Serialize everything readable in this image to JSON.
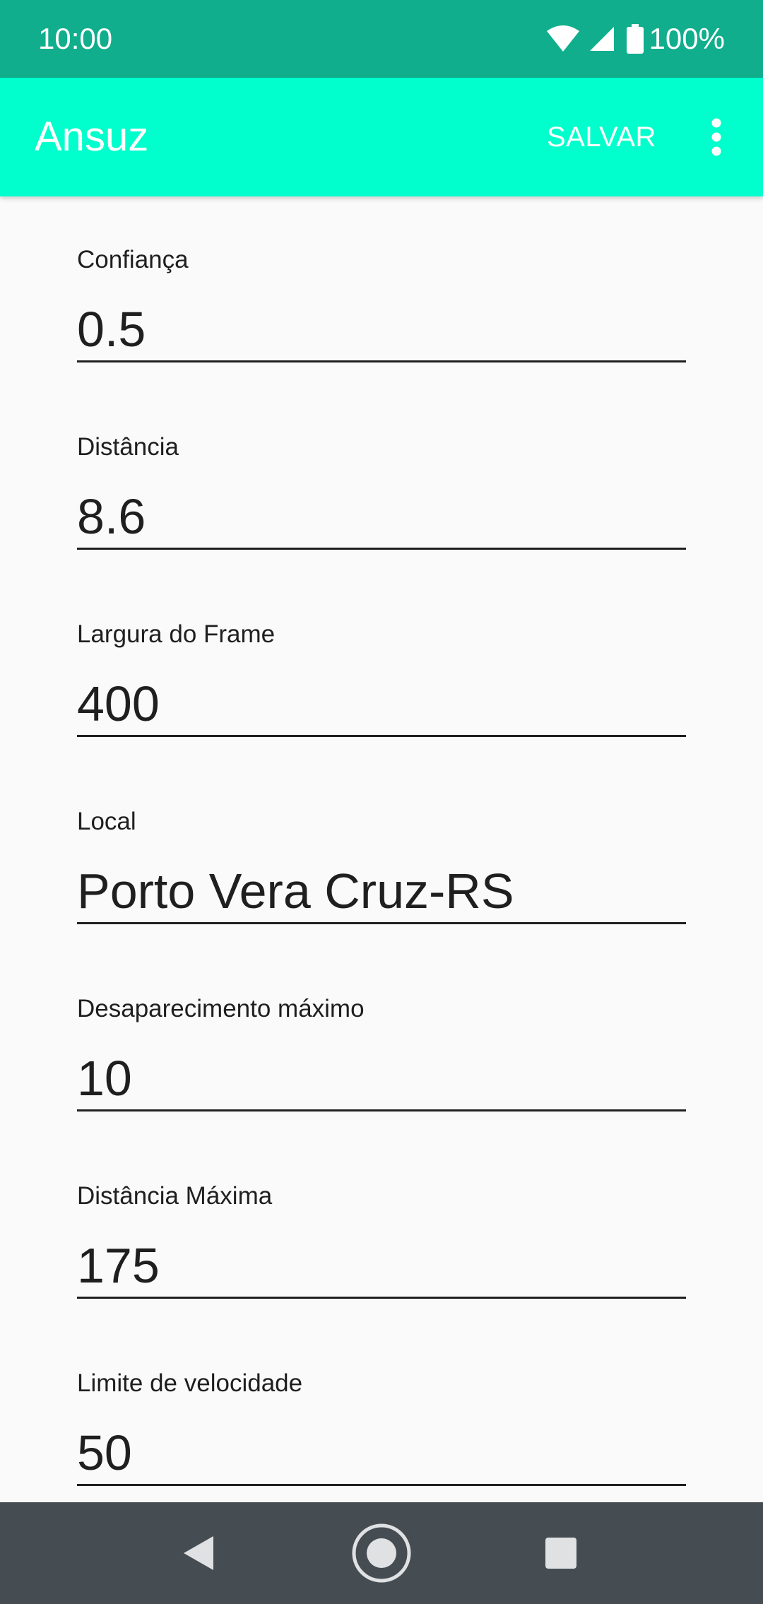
{
  "status_bar": {
    "time": "10:00",
    "battery": "100%",
    "icons": [
      "wifi-icon",
      "cell-signal-icon",
      "battery-icon"
    ]
  },
  "app_bar": {
    "title": "Ansuz",
    "save_label": "SALVAR",
    "overflow_icon": "more-vert-icon"
  },
  "fields": [
    {
      "label": "Confiança",
      "value": "0.5"
    },
    {
      "label": "Distância",
      "value": "8.6"
    },
    {
      "label": "Largura do Frame",
      "value": "400"
    },
    {
      "label": "Local",
      "value": "Porto Vera Cruz-RS"
    },
    {
      "label": "Desaparecimento máximo",
      "value": "10"
    },
    {
      "label": "Distância Máxima",
      "value": "175"
    },
    {
      "label": "Limite de velocidade",
      "value": "50"
    }
  ],
  "nav_bar": {
    "icons": [
      "back-icon",
      "home-icon",
      "recents-icon"
    ]
  },
  "colors": {
    "status_bar": "#10ae8d",
    "app_bar": "#00ffcc",
    "nav_bar": "#454c52",
    "background": "#fafafa"
  }
}
